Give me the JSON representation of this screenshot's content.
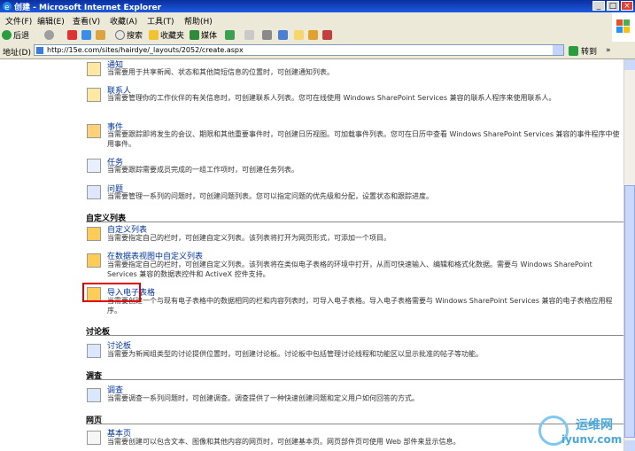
{
  "window": {
    "title": "创建 - Microsoft Internet Explorer",
    "min": "_",
    "max": "□",
    "close": "×"
  },
  "menu": [
    "文件(F)",
    "编辑(E)",
    "查看(V)",
    "收藏(A)",
    "工具(T)",
    "帮助(H)"
  ],
  "toolbar": {
    "back": "后退",
    "search": "搜索",
    "favorites": "收藏夹",
    "media": "媒体"
  },
  "address": {
    "label": "地址(D)",
    "url": "http://15e.com/sites/hairdye/_layouts/2052/create.aspx",
    "go": "转到",
    "links": "»"
  },
  "top_items": [
    {
      "title": "通知",
      "desc": "当需要用于共享新闻、状态和其他简短信息的位置时，可创建通知列表。"
    },
    {
      "title": "联系人",
      "desc": "当需要管理你的工作伙伴的有关信息时，可创建联系人列表。您可在线使用 Windows SharePoint Services 兼容的联系人程序来使用联系人。"
    },
    {
      "title": "事件",
      "desc": "当需要跟踪即将发生的会议、期限和其他重要事件时，可创建日历视图。可加载事件列表。您可在日历中查看 Windows SharePoint Services 兼容的事件程序中使用事件。"
    },
    {
      "title": "任务",
      "desc": "当需要跟踪需要成员完成的一组工作项时，可创建任务列表。"
    },
    {
      "title": "问题",
      "desc": "当需要管理一系列的问题时，可创建问题列表。您可以指定问题的优先级和分配，设置状态和跟踪进度。"
    }
  ],
  "sections": [
    {
      "heading": "自定义列表",
      "items": [
        {
          "title": "自定义列表",
          "desc": "当需要指定自己的栏时，可创建自定义列表。该列表将打开为网页形式，可添加一个项目。"
        },
        {
          "title": "在数据表视图中自定义列表",
          "desc": "当需要指定自己的栏时，可创建自定义列表。该列表将在类似电子表格的环境中打开，从而可快速输入、编辑和格式化数据。需要与 Windows SharePoint Services 兼容的数据表控件和 ActiveX 控件支持。"
        },
        {
          "title": "导入电子表格",
          "desc": "当需要创建一个与现有电子表格中的数据相同的栏和内容列表时，可导入电子表格。导入电子表格需要与 Windows SharePoint Services 兼容的电子表格应用程序。"
        }
      ]
    },
    {
      "heading": "讨论板",
      "items": [
        {
          "title": "讨论板",
          "desc": "当需要为新闻组类型的讨论提供位置时，可创建讨论板。讨论板中包括管理讨论线程和功能区以显示批准的帖子等功能。"
        }
      ]
    },
    {
      "heading": "调查",
      "items": [
        {
          "title": "调查",
          "desc": "当需要调查一系列问题时，可创建调查。调查提供了一种快速创建问题和定义用户如何回答的方式。"
        }
      ]
    },
    {
      "heading": "网页",
      "items": [
        {
          "title": "基本页",
          "desc": "当需要创建可以包含文本、图像和其他内容的网页时，可创建基本页。网页部件页可使用 Web 部件来显示信息。"
        }
      ]
    }
  ],
  "watermark": {
    "text1": "运维网",
    "text2": "iyunv.com"
  },
  "colors": {
    "title_bar": "#1c5be0",
    "link": "#003399",
    "highlight": "#e00000",
    "watermark": "#4aa8dc"
  }
}
